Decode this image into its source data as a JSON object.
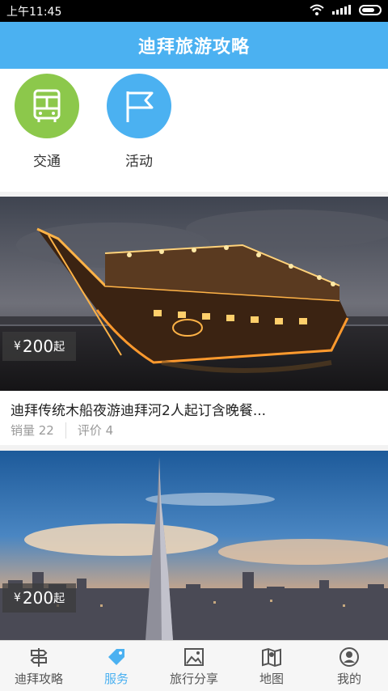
{
  "status_bar": {
    "time": "上午11:45"
  },
  "header": {
    "title": "迪拜旅游攻略"
  },
  "categories": [
    {
      "label": "交通",
      "icon": "bus-icon",
      "color": "#8cc84b"
    },
    {
      "label": "活动",
      "icon": "flag-icon",
      "color": "#4bb1f1"
    }
  ],
  "cards": [
    {
      "price_prefix": "¥",
      "price": "200",
      "price_suffix": "起",
      "title": "迪拜传统木船夜游迪拜河2人起订含晚餐...",
      "sales_label": "销量 22",
      "reviews_label": "评价 4"
    },
    {
      "price_prefix": "¥",
      "price": "200",
      "price_suffix": "起"
    }
  ],
  "tabs": [
    {
      "label": "迪拜攻略",
      "icon": "signpost-icon",
      "active": false
    },
    {
      "label": "服务",
      "icon": "tag-icon",
      "active": true
    },
    {
      "label": "旅行分享",
      "icon": "picture-icon",
      "active": false
    },
    {
      "label": "地图",
      "icon": "map-icon",
      "active": false
    },
    {
      "label": "我的",
      "icon": "user-icon",
      "active": false
    }
  ],
  "colors": {
    "accent": "#4bb1f1",
    "green": "#8cc84b"
  }
}
